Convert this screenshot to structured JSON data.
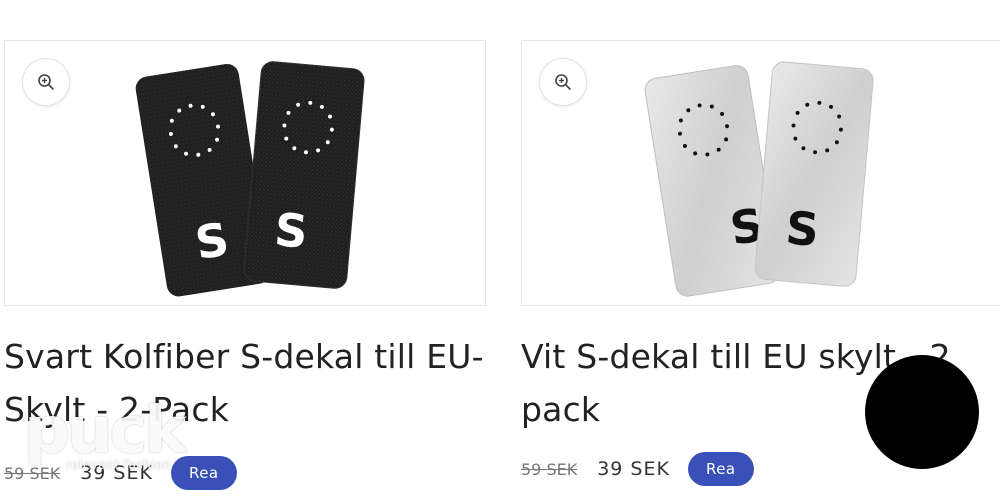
{
  "products": [
    {
      "title": "Svart Kolfiber S-dekal till EU-Skylt - 2-Pack",
      "old_price": "59 SEK",
      "new_price": "39 SEK",
      "badge": "Rea",
      "plate_letter": "S",
      "plate_style": "black carbon fiber",
      "zoom_icon": "zoom-in-icon"
    },
    {
      "title": "Vit S-dekal till EU skylt - 2 pack",
      "old_price": "59 SEK",
      "new_price": "39 SEK",
      "badge": "Rea",
      "plate_letter": "S",
      "plate_style": "silver/white",
      "zoom_icon": "zoom-in-icon"
    }
  ],
  "watermark": {
    "brand": "puck",
    "tagline": "relevant fashion"
  },
  "colors": {
    "badge_bg": "#3950b8",
    "badge_text": "#ffffff",
    "title_text": "#222222"
  }
}
